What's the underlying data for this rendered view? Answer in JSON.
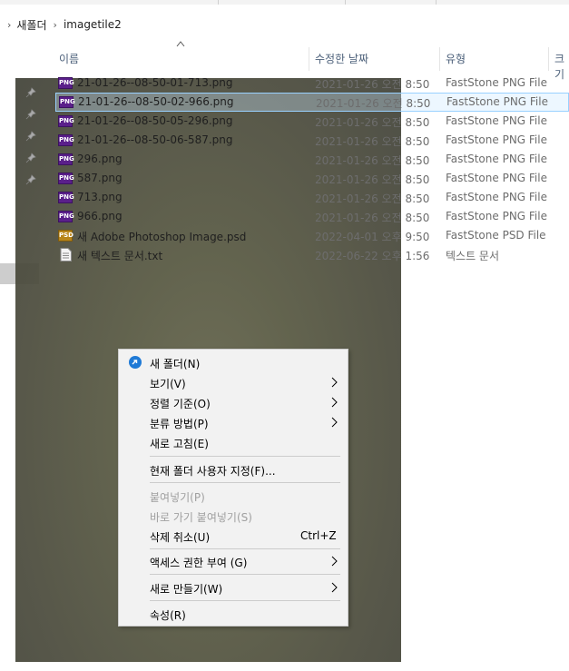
{
  "breadcrumb": {
    "parent": "새폴더",
    "current": "imagetile2"
  },
  "columns": {
    "name": "이름",
    "modified": "수정한 날짜",
    "type": "유형",
    "size": "크기"
  },
  "files": [
    {
      "name": "21-01-26--08-50-01-713.png",
      "date": "2021-01-26 오전 8:50",
      "type": "FastStone PNG File",
      "icon": "png-file-icon",
      "badge": "PNG"
    },
    {
      "name": "21-01-26--08-50-02-966.png",
      "date": "2021-01-26 오전 8:50",
      "type": "FastStone PNG File",
      "icon": "png-file-icon",
      "badge": "PNG"
    },
    {
      "name": "21-01-26--08-50-05-296.png",
      "date": "2021-01-26 오전 8:50",
      "type": "FastStone PNG File",
      "icon": "png-file-icon",
      "badge": "PNG"
    },
    {
      "name": "21-01-26--08-50-06-587.png",
      "date": "2021-01-26 오전 8:50",
      "type": "FastStone PNG File",
      "icon": "png-file-icon",
      "badge": "PNG"
    },
    {
      "name": "296.png",
      "date": "2021-01-26 오전 8:50",
      "type": "FastStone PNG File",
      "icon": "png-file-icon",
      "badge": "PNG"
    },
    {
      "name": "587.png",
      "date": "2021-01-26 오전 8:50",
      "type": "FastStone PNG File",
      "icon": "png-file-icon",
      "badge": "PNG"
    },
    {
      "name": "713.png",
      "date": "2021-01-26 오전 8:50",
      "type": "FastStone PNG File",
      "icon": "png-file-icon",
      "badge": "PNG"
    },
    {
      "name": "966.png",
      "date": "2021-01-26 오전 8:50",
      "type": "FastStone PNG File",
      "icon": "png-file-icon",
      "badge": "PNG"
    },
    {
      "name": "새 Adobe Photoshop Image.psd",
      "date": "2022-04-01 오후 9:50",
      "type": "FastStone PSD File",
      "icon": "psd-file-icon",
      "badge": "PSD"
    },
    {
      "name": "새 텍스트 문서.txt",
      "date": "2022-06-22 오후 1:56",
      "type": "텍스트 문서",
      "icon": "text-file-icon",
      "badge": ""
    }
  ],
  "context_menu": {
    "new_folder": "새 폴더(N)",
    "view": "보기(V)",
    "sort_by": "정렬 기준(O)",
    "group_by": "분류 방법(P)",
    "refresh": "새로 고침(E)",
    "customize": "현재 폴더 사용자 지정(F)...",
    "paste": "붙여넣기(P)",
    "paste_shortcut": "바로 가기 붙여넣기(S)",
    "undo_delete": "삭제 취소(U)",
    "undo_shortcut": "Ctrl+Z",
    "give_access": "액세스 권한 부여 (G)",
    "new": "새로 만들기(W)",
    "properties": "속성(R)"
  }
}
